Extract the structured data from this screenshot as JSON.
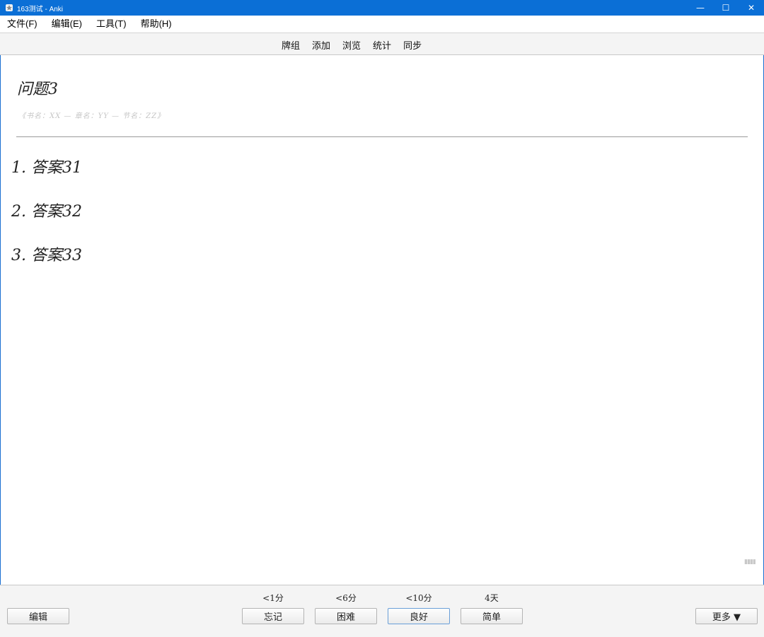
{
  "window": {
    "title": "163测试 - Anki",
    "controls": {
      "minimize": "—",
      "maximize": "☐",
      "close": "✕"
    },
    "icon": "anki-star-icon"
  },
  "menubar": {
    "items": [
      {
        "label": "文件(F)"
      },
      {
        "label": "编辑(E)"
      },
      {
        "label": "工具(T)"
      },
      {
        "label": "帮助(H)"
      }
    ]
  },
  "toolbar": {
    "links": [
      {
        "label": "牌组"
      },
      {
        "label": "添加"
      },
      {
        "label": "浏览"
      },
      {
        "label": "统计"
      },
      {
        "label": "同步"
      }
    ]
  },
  "card": {
    "question": "问题3",
    "source": "《书名：XX — 章名：YY — 节名：ZZ》",
    "answers": [
      {
        "text": "1. 答案31"
      },
      {
        "text": "2. 答案32"
      },
      {
        "text": "3. 答案33"
      }
    ]
  },
  "bottombar": {
    "edit_label": "编辑",
    "more_label": "更多 ▼",
    "answer_buttons": [
      {
        "interval": "<1分",
        "label": "忘记"
      },
      {
        "interval": "<6分",
        "label": "困难"
      },
      {
        "interval": "<10分",
        "label": "良好"
      },
      {
        "interval": "4天",
        "label": "简单"
      }
    ]
  },
  "colors": {
    "titlebar": "#0b6fd6",
    "toolbar_bg": "#f4f4f4",
    "source_text": "#c4c4c4"
  }
}
